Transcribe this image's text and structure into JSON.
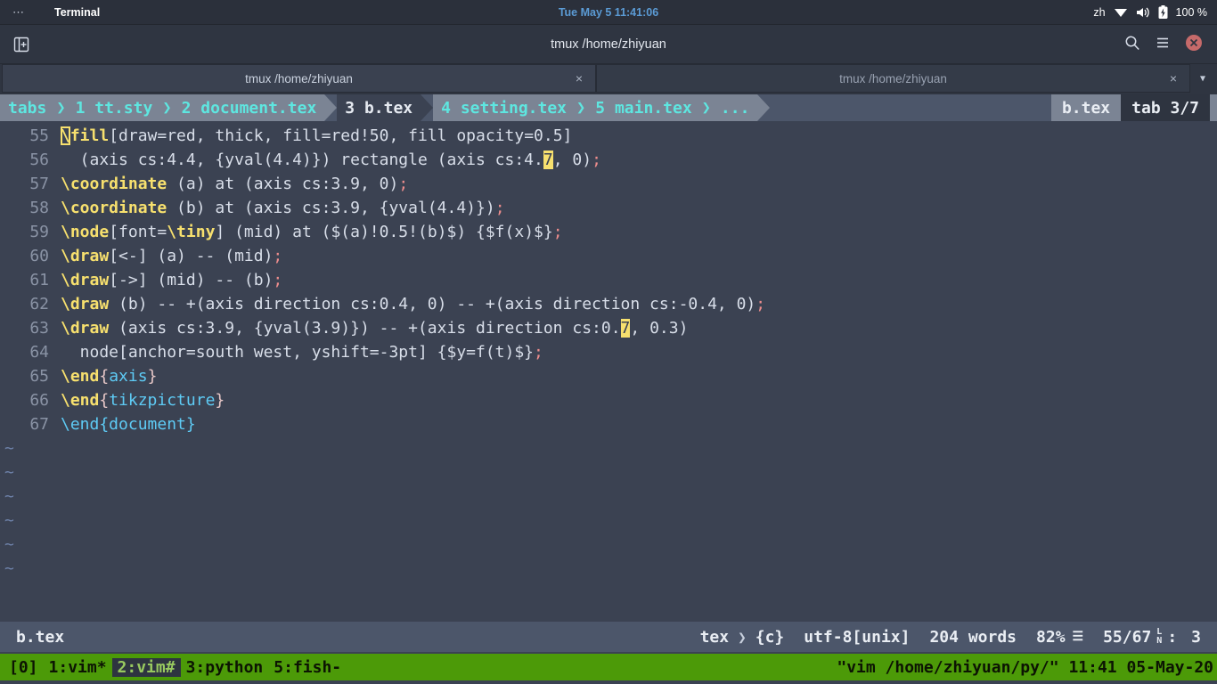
{
  "gnome_panel": {
    "dots": "⋯",
    "app_name": "Terminal",
    "clock": "Tue May 5  11:41:06",
    "input_source": "zh",
    "battery": "100 %",
    "icons": [
      "wifi-icon",
      "volume-icon",
      "battery-icon"
    ]
  },
  "window": {
    "title": "tmux /home/zhiyuan",
    "new_tab_icon": "new-tab-icon",
    "search_icon": "search-icon",
    "menu_icon": "hamburger-menu-icon",
    "close_icon": "close-window-icon"
  },
  "terminal_tabs": {
    "items": [
      {
        "label": "tmux /home/zhiyuan",
        "active": true,
        "close": "×"
      },
      {
        "label": "tmux /home/zhiyuan",
        "active": false,
        "close": "×"
      }
    ],
    "overflow": "▼"
  },
  "vim_tabline": {
    "label": "tabs",
    "separator": "❯",
    "buffers": [
      {
        "index": "1",
        "name": "tt.sty"
      },
      {
        "index": "2",
        "name": "document.tex"
      },
      {
        "index": "3",
        "name": "b.tex"
      },
      {
        "index": "4",
        "name": "setting.tex"
      },
      {
        "index": "5",
        "name": "main.tex"
      }
    ],
    "buffer_labels": [
      "1 tt.sty",
      "2 document.tex",
      "3 b.tex",
      "4 setting.tex",
      "5 main.tex"
    ],
    "overflow": "...",
    "current_file": "b.tex",
    "tab_count": "tab 3/7"
  },
  "editor": {
    "lines": [
      {
        "num": "55",
        "tokens": [
          {
            "t": "\\",
            "c": "hl-box"
          },
          {
            "t": "fill",
            "c": "c-cmd"
          },
          {
            "t": "[draw=red, thick, fill=red!50, fill opacity=0.5]",
            "c": "c-plain"
          }
        ]
      },
      {
        "num": "56",
        "tokens": [
          {
            "t": "  (axis cs:4.4, {yval(4.4)}) rectangle (axis cs:4.",
            "c": "c-plain"
          },
          {
            "t": "7",
            "c": "hl"
          },
          {
            "t": ", 0)",
            "c": "c-plain"
          },
          {
            "t": ";",
            "c": "c-semi"
          }
        ]
      },
      {
        "num": "57",
        "tokens": [
          {
            "t": "\\coordinate",
            "c": "c-cmd"
          },
          {
            "t": " (a) at (axis cs:3.9, 0)",
            "c": "c-plain"
          },
          {
            "t": ";",
            "c": "c-semi"
          }
        ]
      },
      {
        "num": "58",
        "tokens": [
          {
            "t": "\\coordinate",
            "c": "c-cmd"
          },
          {
            "t": " (b) at (axis cs:3.9, {yval(4.4)})",
            "c": "c-plain"
          },
          {
            "t": ";",
            "c": "c-semi"
          }
        ]
      },
      {
        "num": "59",
        "tokens": [
          {
            "t": "\\node",
            "c": "c-cmd"
          },
          {
            "t": "[font=",
            "c": "c-plain"
          },
          {
            "t": "\\tiny",
            "c": "c-cmd"
          },
          {
            "t": "] (mid) at ($(a)!0.5!(b)$) {$f(x)$}",
            "c": "c-plain"
          },
          {
            "t": ";",
            "c": "c-semi"
          }
        ]
      },
      {
        "num": "60",
        "tokens": [
          {
            "t": "\\draw",
            "c": "c-cmd"
          },
          {
            "t": "[<-] (a) -- (mid)",
            "c": "c-plain"
          },
          {
            "t": ";",
            "c": "c-semi"
          }
        ]
      },
      {
        "num": "61",
        "tokens": [
          {
            "t": "\\draw",
            "c": "c-cmd"
          },
          {
            "t": "[->] (mid) -- (b)",
            "c": "c-plain"
          },
          {
            "t": ";",
            "c": "c-semi"
          }
        ]
      },
      {
        "num": "62",
        "tokens": [
          {
            "t": "\\draw",
            "c": "c-cmd"
          },
          {
            "t": " (b) -- +(axis direction cs:0.4, 0) -- +(axis direction cs:-0.4, 0)",
            "c": "c-plain"
          },
          {
            "t": ";",
            "c": "c-semi"
          }
        ]
      },
      {
        "num": "63",
        "tokens": [
          {
            "t": "\\draw",
            "c": "c-cmd"
          },
          {
            "t": " (axis cs:3.9, {yval(3.9)}) -- +(axis direction cs:0.",
            "c": "c-plain"
          },
          {
            "t": "7",
            "c": "hl"
          },
          {
            "t": ", 0.3)",
            "c": "c-plain"
          }
        ]
      },
      {
        "num": "64",
        "tokens": [
          {
            "t": "  node[anchor=south west, yshift=-3pt] {$y=f(t)$}",
            "c": "c-plain"
          },
          {
            "t": ";",
            "c": "c-semi"
          }
        ]
      },
      {
        "num": "65",
        "tokens": [
          {
            "t": "\\end",
            "c": "c-cmd"
          },
          {
            "t": "{",
            "c": "c-punct"
          },
          {
            "t": "axis",
            "c": "c-name"
          },
          {
            "t": "}",
            "c": "c-punct"
          }
        ]
      },
      {
        "num": "66",
        "tokens": [
          {
            "t": "\\end",
            "c": "c-cmd"
          },
          {
            "t": "{",
            "c": "c-punct"
          },
          {
            "t": "tikzpicture",
            "c": "c-name"
          },
          {
            "t": "}",
            "c": "c-punct"
          }
        ]
      },
      {
        "num": "67",
        "tokens": [
          {
            "t": "\\end{document}",
            "c": "c-blue"
          }
        ]
      }
    ],
    "empty_marker": "~",
    "empty_count": 6
  },
  "statusline": {
    "filename": "b.tex",
    "filetype": "tex",
    "separator": "❯",
    "mode_marker": "{c}",
    "encoding": "utf-8[unix]",
    "word_count": "204 words",
    "percent": "82%",
    "lines_icon": "☰",
    "position": "55/67",
    "ln_top": "L",
    "ln_bottom": "N",
    "colon": ":",
    "column": "3"
  },
  "tmux": {
    "session": "[0]",
    "windows": [
      {
        "label": "1:vim*",
        "active": false
      },
      {
        "label": "2:vim#",
        "active": true
      },
      {
        "label": "3:python",
        "active": false
      },
      {
        "label": "5:fish-",
        "active": false
      }
    ],
    "right": "\"vim /home/zhiyuan/py/\" 11:41 05-May-20"
  },
  "colors": {
    "panel_bg": "#2b303b",
    "window_bg": "#2f3541",
    "editor_bg": "#3b4252",
    "airline_bg": "#4c566a",
    "airline_mid": "#7b8494",
    "accent_cyan": "#5ee6e0",
    "accent_yellow": "#f7e06e",
    "tmux_green": "#4c9a08",
    "clock_blue": "#5b9bd5"
  }
}
